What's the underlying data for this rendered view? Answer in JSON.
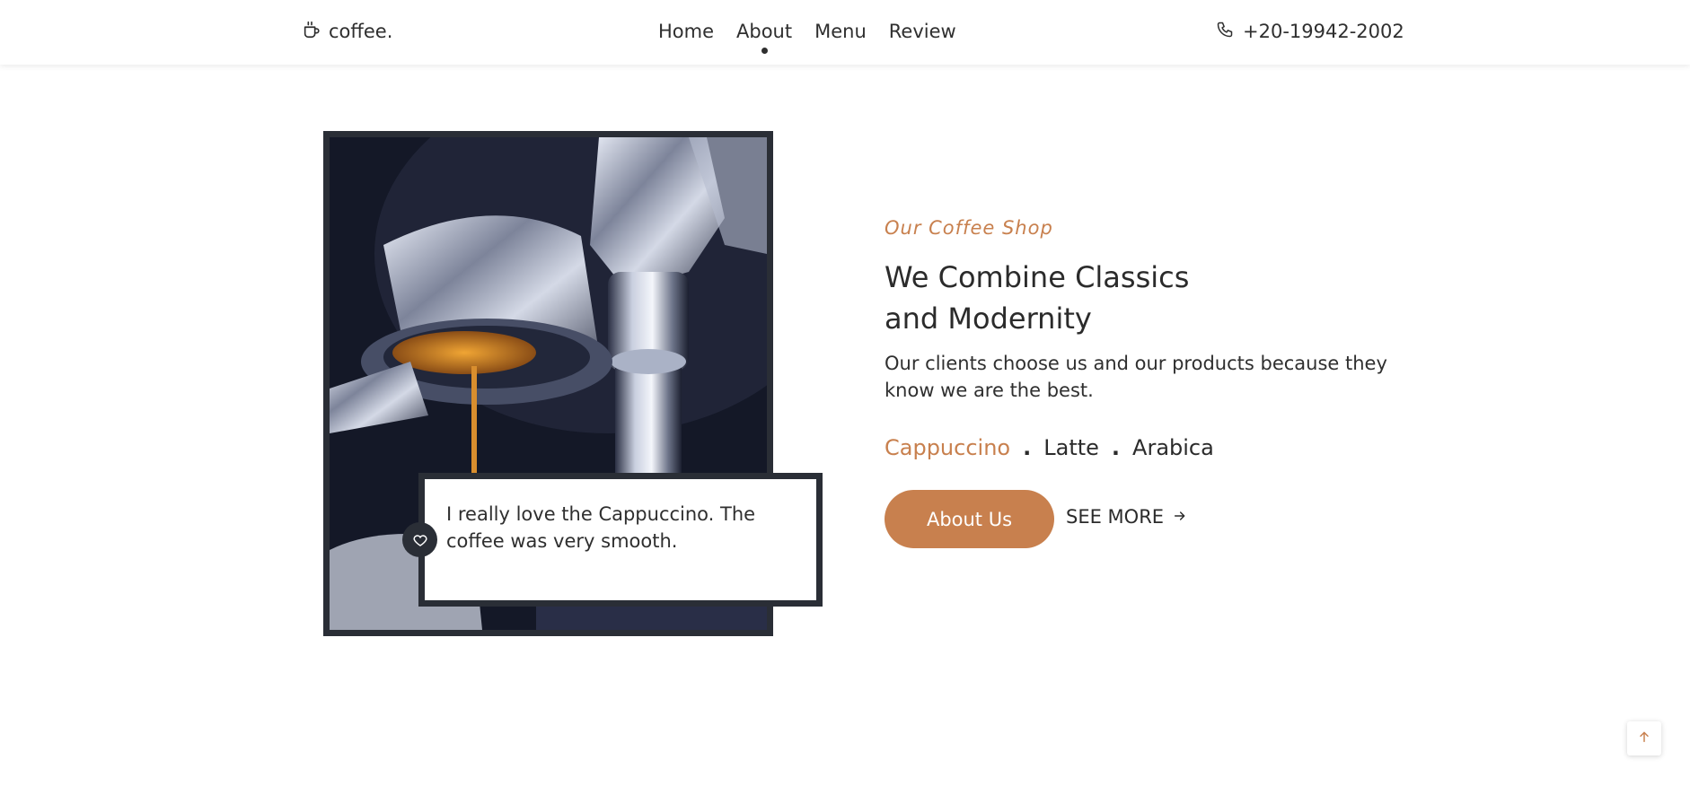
{
  "header": {
    "brand": "coffee.",
    "brand_icon": "coffee-cup-icon",
    "nav": [
      "Home",
      "About",
      "Menu",
      "Review"
    ],
    "active_nav": "About",
    "phone": "+20-19942-2002",
    "phone_icon": "phone-icon"
  },
  "about": {
    "eyebrow": "Our Coffee Shop",
    "headline_line1": "We Combine Classics",
    "headline_line2": "and Modernity",
    "description": "Our clients choose us and our products because they know we are the best.",
    "tags": [
      "Cappuccino",
      "Latte",
      "Arabica"
    ],
    "active_tag": "Cappuccino",
    "about_button": "About Us",
    "see_more": "SEE MORE",
    "review": "I really love the Cappuccino. The coffee was very smooth."
  },
  "icons": {
    "heart": "heart-icon",
    "arrow_right": "arrow-right-icon",
    "scroll_top": "arrow-up-icon"
  },
  "colors": {
    "accent": "#c8804e",
    "dark": "#2a2e36",
    "text": "#2b2b2b"
  }
}
